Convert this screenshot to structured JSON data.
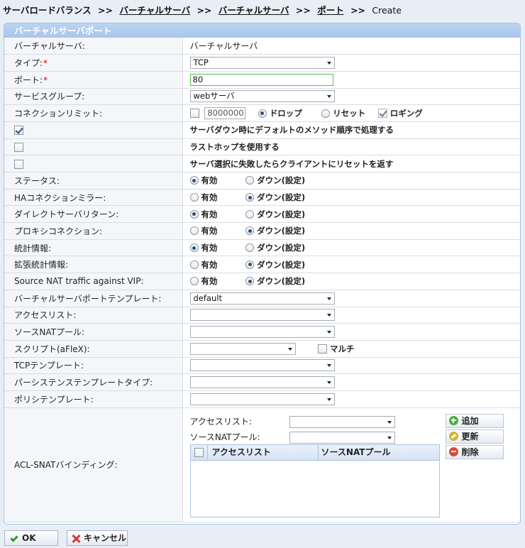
{
  "breadcrumb": {
    "root": "サーバロードバランス",
    "sep": ">>",
    "link1": "バーチャルサーバ",
    "link2": "バーチャルサーバ",
    "link3": "ポート",
    "current": "Create"
  },
  "panel": {
    "title": "バーチャルサーバポート"
  },
  "required_mark": "*",
  "rows": {
    "vserver": {
      "label": "バーチャルサーバ:",
      "value": "バーチャルサーバ"
    },
    "type": {
      "label": "タイプ:",
      "value": "TCP"
    },
    "port": {
      "label": "ポート:",
      "value": "80"
    },
    "service_group": {
      "label": "サービスグループ:",
      "value": "webサーバ"
    },
    "conn_limit": {
      "label": "コネクションリミット:",
      "enabled": false,
      "value": "8000000",
      "drop": "ドロップ",
      "reset": "リセット",
      "logging": "ロギング",
      "logging_checked": true,
      "selected": "drop"
    },
    "default_method": {
      "checked": true,
      "text": "サーバダウン時にデフォルトのメソッド順序で処理する"
    },
    "last_hop": {
      "checked": false,
      "text": "ラストホップを使用する"
    },
    "reset_on_fail": {
      "checked": false,
      "text": "サーバ選択に失敗したらクライアントにリセットを返す"
    },
    "status": {
      "label": "ステータス:",
      "selected": "enable"
    },
    "ha_mirror": {
      "label": "HAコネクションミラー:",
      "selected": "disable"
    },
    "dsr": {
      "label": "ダイレクトサーバリターン:",
      "selected": "enable"
    },
    "proxy": {
      "label": "プロキシコネクション:",
      "selected": "disable"
    },
    "stats": {
      "label": "統計情報:",
      "selected": "enable"
    },
    "ext_stats": {
      "label": "拡張統計情報:",
      "selected": "disable"
    },
    "source_nat": {
      "label": "Source NAT traffic against VIP:",
      "selected": "disable"
    },
    "vport_template": {
      "label": "バーチャルサーバポートテンプレート:",
      "value": "default"
    },
    "access_list": {
      "label": "アクセスリスト:",
      "value": ""
    },
    "snat_pool": {
      "label": "ソースNATプール:",
      "value": ""
    },
    "script": {
      "label": "スクリプト(aFleX):",
      "value": "",
      "multi": "マルチ",
      "multi_checked": false
    },
    "tcp_template": {
      "label": "TCPテンプレート:",
      "value": ""
    },
    "persist_type": {
      "label": "パーシステンステンプレートタイプ:",
      "value": ""
    },
    "policy_template": {
      "label": "ポリシテンプレート:",
      "value": ""
    }
  },
  "radio": {
    "enable": "有効",
    "disable": "ダウン(設定)"
  },
  "acl": {
    "label": "ACL-SNATバインディング:",
    "access_list_label": "アクセスリスト:",
    "snat_pool_label": "ソースNATプール:",
    "col_access_list": "アクセスリスト",
    "col_snat_pool": "ソースNATプール",
    "add": "追加",
    "update": "更新",
    "delete": "削除"
  },
  "buttons": {
    "ok": "OK",
    "cancel": "キャンセル"
  }
}
